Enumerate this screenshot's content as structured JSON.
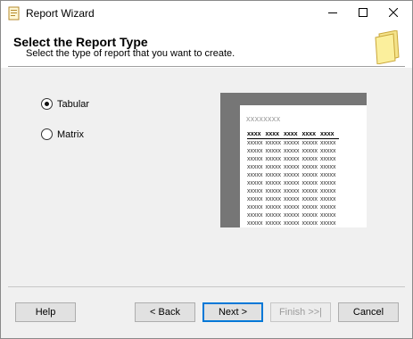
{
  "window": {
    "title": "Report Wizard"
  },
  "header": {
    "title": "Select the Report Type",
    "subtitle": "Select the type of report that you want to create."
  },
  "report_types": [
    {
      "label": "Tabular",
      "selected": true
    },
    {
      "label": "Matrix",
      "selected": false
    }
  ],
  "preview": {
    "title_placeholder": "xxxxxxxx",
    "columns": [
      "xxxx",
      "xxxx",
      "xxxx",
      "xxxx",
      "xxxx"
    ],
    "rows": [
      [
        "xxxxx",
        "xxxxx",
        "xxxxx",
        "xxxxx",
        "xxxxx"
      ],
      [
        "xxxxx",
        "xxxxx",
        "xxxxx",
        "xxxxx",
        "xxxxx"
      ],
      [
        "xxxxx",
        "xxxxx",
        "xxxxx",
        "xxxxx",
        "xxxxx"
      ],
      [
        "xxxxx",
        "xxxxx",
        "xxxxx",
        "xxxxx",
        "xxxxx"
      ],
      [
        "xxxxx",
        "xxxxx",
        "xxxxx",
        "xxxxx",
        "xxxxx"
      ],
      [
        "xxxxx",
        "xxxxx",
        "xxxxx",
        "xxxxx",
        "xxxxx"
      ],
      [
        "xxxxx",
        "xxxxx",
        "xxxxx",
        "xxxxx",
        "xxxxx"
      ],
      [
        "xxxxx",
        "xxxxx",
        "xxxxx",
        "xxxxx",
        "xxxxx"
      ],
      [
        "xxxxx",
        "xxxxx",
        "xxxxx",
        "xxxxx",
        "xxxxx"
      ],
      [
        "xxxxx",
        "xxxxx",
        "xxxxx",
        "xxxxx",
        "xxxxx"
      ],
      [
        "xxxxx",
        "xxxxx",
        "xxxxx",
        "xxxxx",
        "xxxxx"
      ],
      [
        "xxxxx",
        "xxxxx",
        "xxxxx",
        "xxxxx",
        "xxxxx"
      ]
    ]
  },
  "buttons": {
    "help": "Help",
    "back": "< Back",
    "next": "Next >",
    "finish": "Finish >>|",
    "cancel": "Cancel"
  },
  "icons": {
    "app": "report-wizard-icon",
    "header": "report-page-icon",
    "minimize": "minimize-icon",
    "maximize": "maximize-icon",
    "close": "close-icon"
  },
  "colors": {
    "accent": "#0078d7",
    "preview_frame": "#767676"
  }
}
